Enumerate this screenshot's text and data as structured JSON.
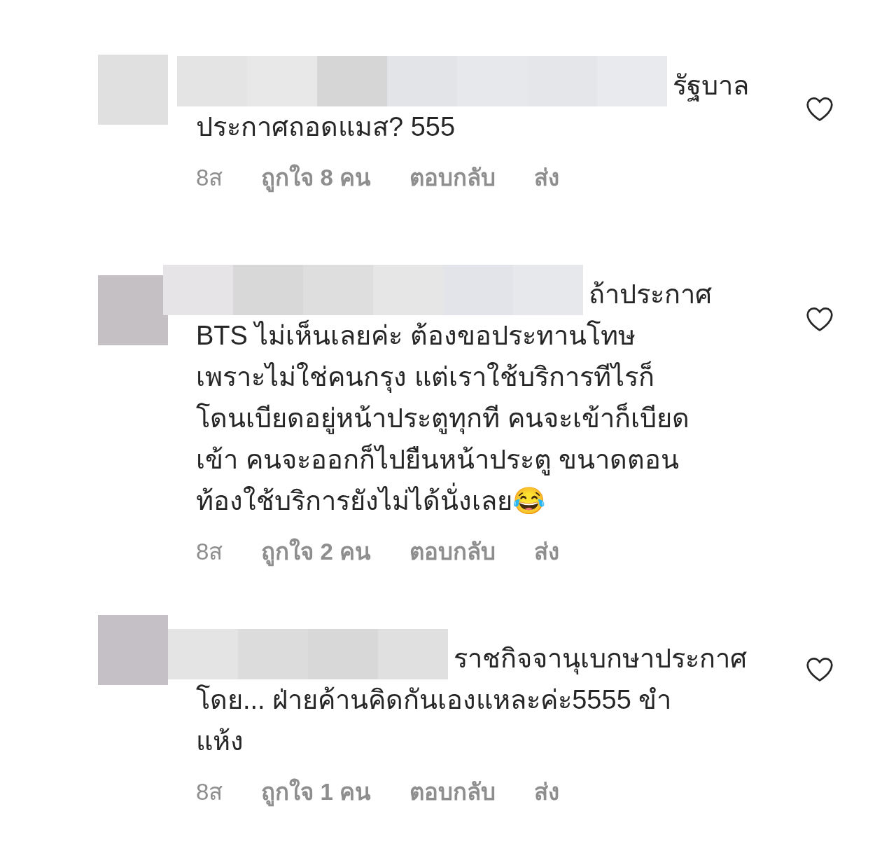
{
  "comments": [
    {
      "first_line": "รัฐบาล",
      "body": "ประกาศถอดแมส? 555",
      "time": "8ส",
      "likes": "ถูกใจ 8 คน",
      "reply": "ตอบกลับ",
      "send": "ส่ง",
      "liked": false
    },
    {
      "first_line": "ถ้าประกาศ",
      "body": "BTS ไม่เห็นเลยค่ะ ต้องขอประทานโทษ\nเพราะไม่ใช่คนกรุง แต่เราใช้บริการทีไรก็\nโดนเบียดอยู่หน้าประตูทุกที คนจะเข้าก็เบียด\nเข้า คนจะออกก็ไปยืนหน้าประตู ขนาดตอน\nท้องใช้บริการยังไม่ได้นั่งเลย😂",
      "time": "8ส",
      "likes": "ถูกใจ 2 คน",
      "reply": "ตอบกลับ",
      "send": "ส่ง",
      "liked": false
    },
    {
      "first_line": "ราชกิจจานุเบกษาประกาศ",
      "body": "โดย... ฝ่ายค้านคิดกันเองแหละค่ะ5555 ขำ\nแห้ง",
      "time": "8ส",
      "likes": "ถูกใจ 1 คน",
      "reply": "ตอบกลับ",
      "send": "ส่ง",
      "liked": false
    }
  ]
}
